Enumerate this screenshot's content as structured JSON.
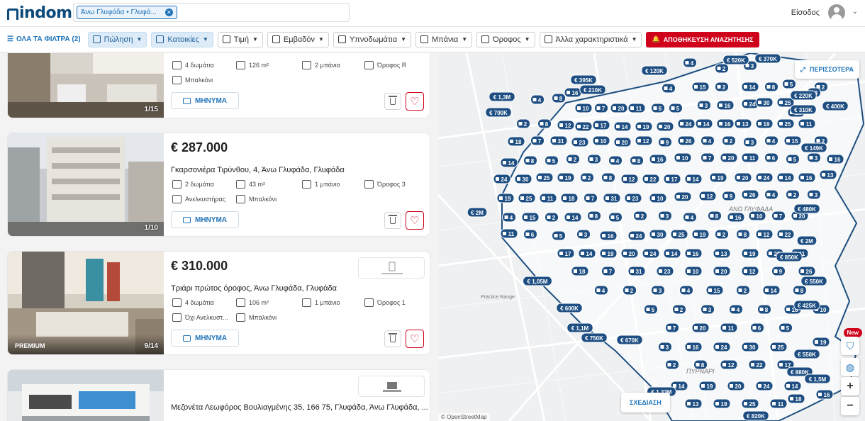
{
  "header": {
    "logo": "indomio",
    "search_chip": "Άνω Γλυφάδα • Γλυφά...",
    "login": "Είσοδος"
  },
  "filters": {
    "all": "ΟΛΑ ΤΑ ΦΙΛΤΡΑ (2)",
    "sale": "Πώληση",
    "homes": "Κατοικίες",
    "price": "Τιμή",
    "area": "Εμβαδόν",
    "bedrooms": "Υπνοδωμάτια",
    "bathrooms": "Μπάνια",
    "floor": "Όροφος",
    "other": "Άλλα χαρακτηριστικά",
    "save": "ΑΠΟΘΗΚΕΥΣΗ ΑΝΑΖΗΤΗΣΗΣ"
  },
  "listings": [
    {
      "photo_counter": "1/15",
      "features": [
        "4 δωμάτια",
        "126 m²",
        "2 μπάνια",
        "Όροφος R",
        "Μπαλκόνι"
      ],
      "message": "ΜΗΝΥΜΑ"
    },
    {
      "price": "€ 287.000",
      "title": "Γκαρσονιέρα Τιρύνθου, 4, Άνω Γλυφάδα, Γλυφάδα",
      "photo_counter": "1/10",
      "features": [
        "2 δωμάτια",
        "43 m²",
        "1 μπάνιο",
        "Όροφος 3",
        "Ανελκυστήρας",
        "Μπαλκόνι"
      ],
      "message": "ΜΗΝΥΜΑ"
    },
    {
      "price": "€ 310.000",
      "title": "Τριάρι πρώτος όροφος, Άνω Γλυφάδα, Γλυφάδα",
      "photo_counter": "9/14",
      "premium": "PREMIUM",
      "features": [
        "4 δωμάτια",
        "106 m²",
        "1 μπάνιο",
        "Όροφος 1",
        "Όχι Ανελκυστ...",
        "Μπαλκόνι"
      ],
      "message": "ΜΗΝΥΜΑ"
    },
    {
      "title": "Μεζονέτα Λεωφόρος Βουλιαγμένης 35, 166 75, Γλυφάδα, Άνω Γλυφάδα, ..."
    }
  ],
  "map": {
    "more": "ΠΕΡΙΣΣΟΤΕΡΑ",
    "draw": "ΣΧΕΔΙΑΣΗ",
    "new_badge": "New",
    "attribution": "© OpenStreetMap",
    "area_labels": [
      "ΑΝΩ ΓΛΥΦΑΔΑ",
      "ΠΥΡΝΑΡΙ",
      "Practice Range"
    ],
    "price_pins": [
      "€ 120K",
      "€ 395K",
      "€ 210K",
      "€ 1,3M",
      "€ 700K",
      "€ 520K",
      "€ 370K",
      "€ 220K",
      "€ 400K",
      "€ 310K",
      "€ 149K",
      "€ 2M",
      "€ 480K",
      "€ 2M",
      "€ 850K",
      "€ 1,05M",
      "€ 550K",
      "€ 600K",
      "€ 425K",
      "€ 1,1M",
      "€ 750K",
      "€ 670K",
      "€ 550K",
      "€ 880K",
      "€ 1,5M",
      "€ 1,33M",
      "€ 820K"
    ],
    "count_pins": [
      "4",
      "2",
      "3",
      "4",
      "15",
      "2",
      "14",
      "8",
      "5",
      "2",
      "3",
      "4",
      "8",
      "16",
      "10",
      "7",
      "20",
      "11",
      "6",
      "5",
      "3",
      "16",
      "24",
      "30",
      "25",
      "19",
      "2",
      "8",
      "12",
      "22",
      "17",
      "14",
      "19",
      "20",
      "24",
      "14",
      "16",
      "13",
      "19",
      "25",
      "11",
      "18",
      "7",
      "31",
      "23",
      "10",
      "20",
      "12",
      "9",
      "26"
    ]
  }
}
